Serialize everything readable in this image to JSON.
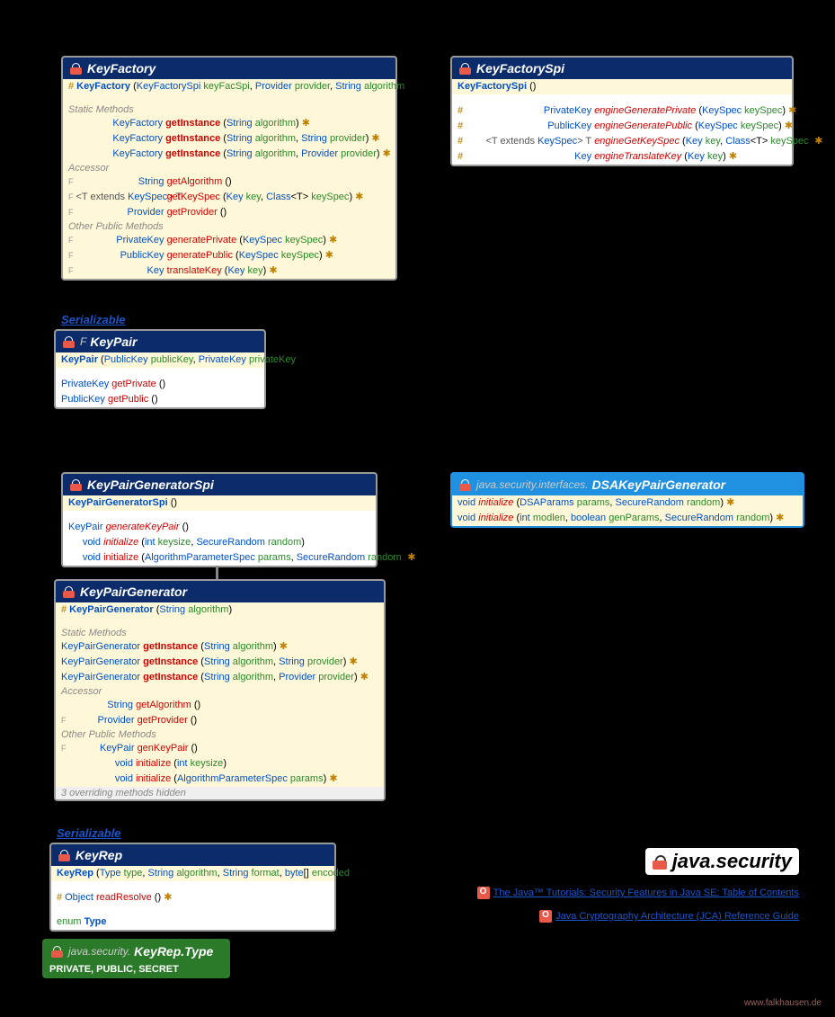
{
  "keyFactory": {
    "title": "KeyFactory",
    "constructor": {
      "sym": "#",
      "name": "KeyFactory",
      "sig": "(KeyFactorySpi keyFacSpi, Provider provider, String algorithm)"
    },
    "sections": {
      "static": "Static Methods",
      "accessor": "Accessor",
      "other": "Other Public Methods"
    },
    "staticMethods": [
      {
        "ret": "KeyFactory",
        "name": "getInstance",
        "sig": "(String algorithm)",
        "ex": true
      },
      {
        "ret": "KeyFactory",
        "name": "getInstance",
        "sig": "(String algorithm, String provider)",
        "ex": true
      },
      {
        "ret": "KeyFactory",
        "name": "getInstance",
        "sig": "(String algorithm, Provider provider)",
        "ex": true
      }
    ],
    "accessors": [
      {
        "mod": "F",
        "ret": "String",
        "name": "getAlgorithm",
        "sig": "()"
      },
      {
        "mod": "F",
        "generic": "<T extends KeySpec> T",
        "name": "getKeySpec",
        "sig": "(Key key, Class<T> keySpec)",
        "ex": true
      },
      {
        "mod": "F",
        "ret": "Provider",
        "name": "getProvider",
        "sig": "()"
      }
    ],
    "others": [
      {
        "mod": "F",
        "ret": "PrivateKey",
        "name": "generatePrivate",
        "sig": "(KeySpec keySpec)",
        "ex": true
      },
      {
        "mod": "F",
        "ret": "PublicKey",
        "name": "generatePublic",
        "sig": "(KeySpec keySpec)",
        "ex": true
      },
      {
        "mod": "F",
        "ret": "Key",
        "name": "translateKey",
        "sig": "(Key key)",
        "ex": true
      }
    ]
  },
  "keyFactorySpi": {
    "title": "KeyFactorySpi",
    "constructor": {
      "name": "KeyFactorySpi",
      "sig": "()"
    },
    "methods": [
      {
        "sym": "#",
        "ret": "PrivateKey",
        "name": "engineGeneratePrivate",
        "sig": "(KeySpec keySpec)",
        "ex": true
      },
      {
        "sym": "#",
        "ret": "PublicKey",
        "name": "engineGeneratePublic",
        "sig": "(KeySpec keySpec)",
        "ex": true
      },
      {
        "sym": "#",
        "generic": "<T extends KeySpec> T",
        "name": "engineGetKeySpec",
        "sig": "(Key key, Class<T> keySpec)",
        "ex": true
      },
      {
        "sym": "#",
        "ret": "Key",
        "name": "engineTranslateKey",
        "sig": "(Key key)",
        "ex": true
      }
    ]
  },
  "serializable": "Serializable",
  "keyPair": {
    "title": "KeyPair",
    "prefix": "F",
    "constructor": {
      "name": "KeyPair",
      "sig": "(PublicKey publicKey, PrivateKey privateKey)"
    },
    "methods": [
      {
        "ret": "PrivateKey",
        "name": "getPrivate",
        "sig": "()"
      },
      {
        "ret": "PublicKey",
        "name": "getPublic",
        "sig": "()"
      }
    ]
  },
  "keyPairGenSpi": {
    "title": "KeyPairGeneratorSpi",
    "constructor": {
      "name": "KeyPairGeneratorSpi",
      "sig": "()"
    },
    "methods": [
      {
        "ret": "KeyPair",
        "name": "generateKeyPair",
        "sig": "()",
        "italic": true
      },
      {
        "ret": "void",
        "name": "initialize",
        "sig": "(int keysize, SecureRandom random)",
        "italic": true
      },
      {
        "ret": "void",
        "name": "initialize",
        "sig": "(AlgorithmParameterSpec params, SecureRandom random)",
        "ex": true
      }
    ]
  },
  "dsaKeyPairGen": {
    "prefix": "java.security.interfaces.",
    "title": "DSAKeyPairGenerator",
    "methods": [
      {
        "ret": "void",
        "name": "initialize",
        "sig": "(DSAParams params, SecureRandom random)",
        "ex": true,
        "italic": true
      },
      {
        "ret": "void",
        "name": "initialize",
        "sig": "(int modlen, boolean genParams, SecureRandom random)",
        "ex": true,
        "italic": true
      }
    ]
  },
  "keyPairGen": {
    "title": "KeyPairGenerator",
    "constructor": {
      "sym": "#",
      "name": "KeyPairGenerator",
      "sig": "(String algorithm)"
    },
    "sections": {
      "static": "Static Methods",
      "accessor": "Accessor",
      "other": "Other Public Methods"
    },
    "staticMethods": [
      {
        "ret": "KeyPairGenerator",
        "name": "getInstance",
        "sig": "(String algorithm)",
        "ex": true
      },
      {
        "ret": "KeyPairGenerator",
        "name": "getInstance",
        "sig": "(String algorithm, String provider)",
        "ex": true
      },
      {
        "ret": "KeyPairGenerator",
        "name": "getInstance",
        "sig": "(String algorithm, Provider provider)",
        "ex": true
      }
    ],
    "accessors": [
      {
        "ret": "String",
        "name": "getAlgorithm",
        "sig": "()"
      },
      {
        "mod": "F",
        "ret": "Provider",
        "name": "getProvider",
        "sig": "()"
      }
    ],
    "others": [
      {
        "mod": "F",
        "ret": "KeyPair",
        "name": "genKeyPair",
        "sig": "()"
      },
      {
        "ret": "void",
        "name": "initialize",
        "sig": "(int keysize)"
      },
      {
        "ret": "void",
        "name": "initialize",
        "sig": "(AlgorithmParameterSpec params)",
        "ex": true
      }
    ],
    "footer": "3 overriding methods hidden"
  },
  "keyRep": {
    "title": "KeyRep",
    "constructor": {
      "name": "KeyRep",
      "sig": "(Type type, String algorithm, String format, byte[] encoded)"
    },
    "methods": [
      {
        "sym": "#",
        "ret": "Object",
        "name": "readResolve",
        "sig": "()",
        "ex": true
      }
    ],
    "enumDecl": "enum Type"
  },
  "keyRepType": {
    "prefix": "java.security.",
    "title": "KeyRep.Type",
    "values": "PRIVATE, PUBLIC, SECRET"
  },
  "packageLabel": "java.security",
  "links": {
    "tutorials": "The Java™ Tutorials: Security Features in Java SE: Table of Contents",
    "jca": "Java Cryptography Architecture (JCA) Reference Guide"
  },
  "watermark": "www.falkhausen.de"
}
